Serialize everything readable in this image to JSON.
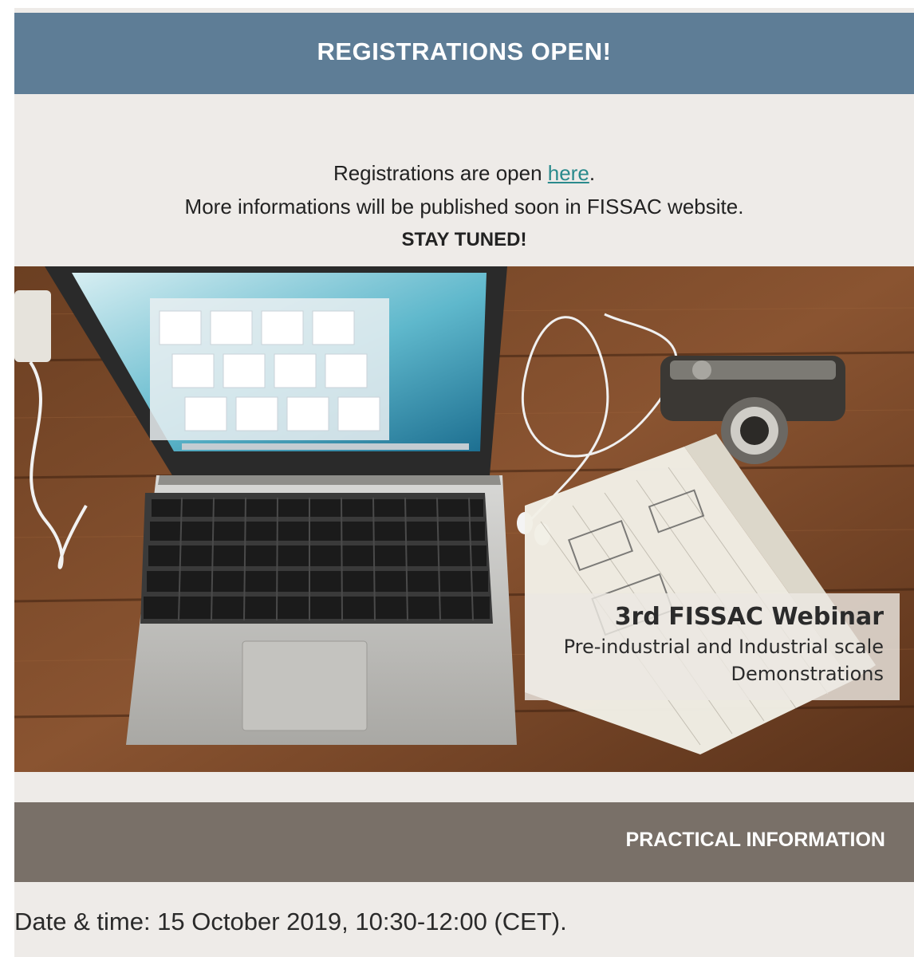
{
  "header": {
    "title": "REGISTRATIONS OPEN!"
  },
  "intro": {
    "line1_prefix": "Registrations are open ",
    "line1_link": "here",
    "line1_suffix": ".",
    "line2": "More informations will be published soon in FISSAC website.",
    "line3": "STAY TUNED!"
  },
  "hero": {
    "caption_title": "3rd FISSAC Webinar",
    "caption_line1": "Pre-industrial and Industrial scale",
    "caption_line2": "Demonstrations"
  },
  "practical": {
    "label": "PRACTICAL INFORMATION"
  },
  "details": {
    "datetime": "Date & time: 15 October 2019, 10:30-12:00 (CET)."
  },
  "colors": {
    "header_bg": "#5e7d96",
    "practical_bg": "#797068",
    "page_bg": "#eeebe8",
    "link": "#2a8a8c"
  }
}
